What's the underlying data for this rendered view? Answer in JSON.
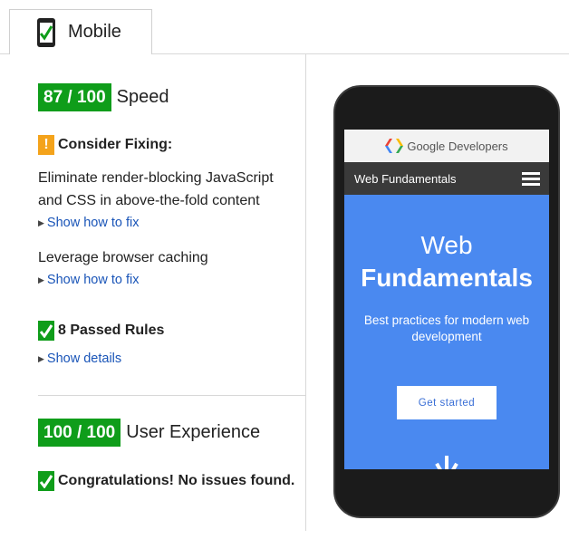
{
  "tab": {
    "label": "Mobile",
    "icon": "phone-check-icon"
  },
  "speed": {
    "score": "87 / 100",
    "label": "Speed",
    "consider_fixing": "Consider Fixing:",
    "rules": [
      {
        "text_line1": "Eliminate render-blocking JavaScript",
        "text_line2": "and CSS in above-the-fold content",
        "link": "Show how to fix"
      },
      {
        "text_line1": "Leverage browser caching",
        "link": "Show how to fix"
      }
    ],
    "passed": "8 Passed Rules",
    "details_link": "Show details"
  },
  "ux": {
    "score": "100 / 100",
    "label": "User Experience",
    "message": "Congratulations! No issues found."
  },
  "phone": {
    "brand": "Google Developers",
    "nav_title": "Web Fundamentals",
    "hero_line1": "Web",
    "hero_line2": "Fundamentals",
    "subtitle": "Best practices for modern web development",
    "cta": "Get started"
  },
  "colors": {
    "pass": "#0f9d1a",
    "warn": "#f4a31b",
    "link": "#1a55b8",
    "hero": "#4a89f0"
  }
}
